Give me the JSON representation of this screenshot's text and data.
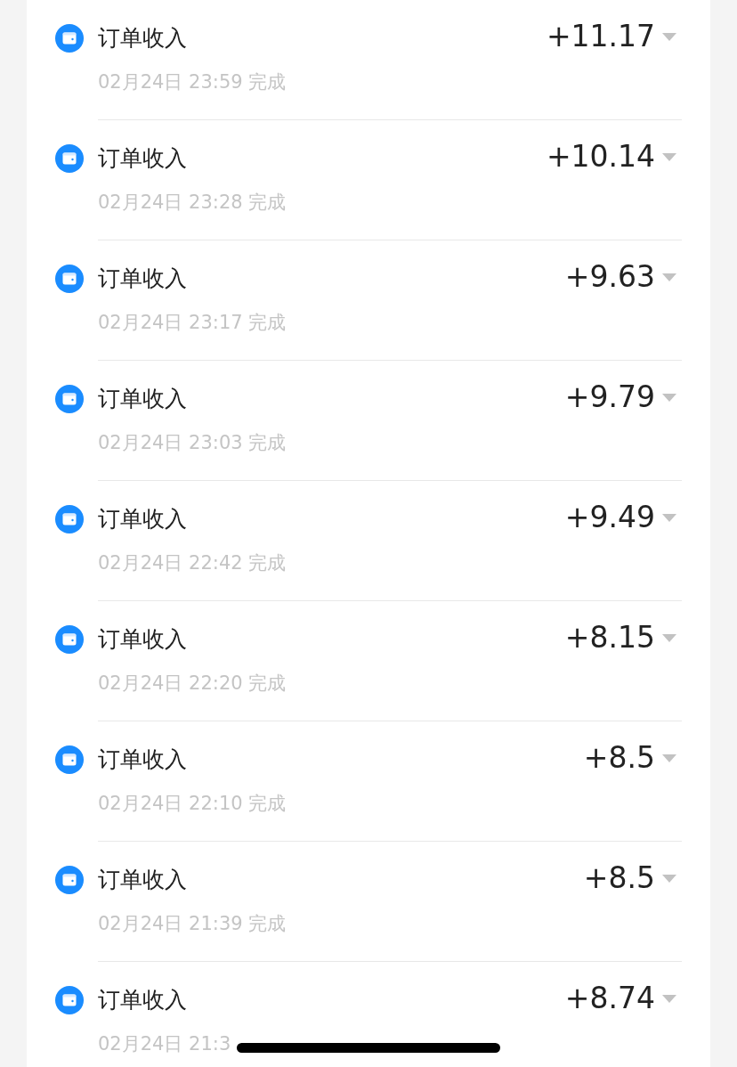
{
  "records": [
    {
      "title": "订单收入",
      "time": "02月24日 23:59 完成",
      "amount": "+11.17"
    },
    {
      "title": "订单收入",
      "time": "02月24日 23:28 完成",
      "amount": "+10.14"
    },
    {
      "title": "订单收入",
      "time": "02月24日 23:17 完成",
      "amount": "+9.63"
    },
    {
      "title": "订单收入",
      "time": "02月24日 23:03 完成",
      "amount": "+9.79"
    },
    {
      "title": "订单收入",
      "time": "02月24日 22:42 完成",
      "amount": "+9.49"
    },
    {
      "title": "订单收入",
      "time": "02月24日 22:20 完成",
      "amount": "+8.15"
    },
    {
      "title": "订单收入",
      "time": "02月24日 22:10 完成",
      "amount": "+8.5"
    },
    {
      "title": "订单收入",
      "time": "02月24日 21:39 完成",
      "amount": "+8.5"
    },
    {
      "title": "订单收入",
      "time": "02月24日 21:3",
      "amount": "+8.74"
    }
  ]
}
